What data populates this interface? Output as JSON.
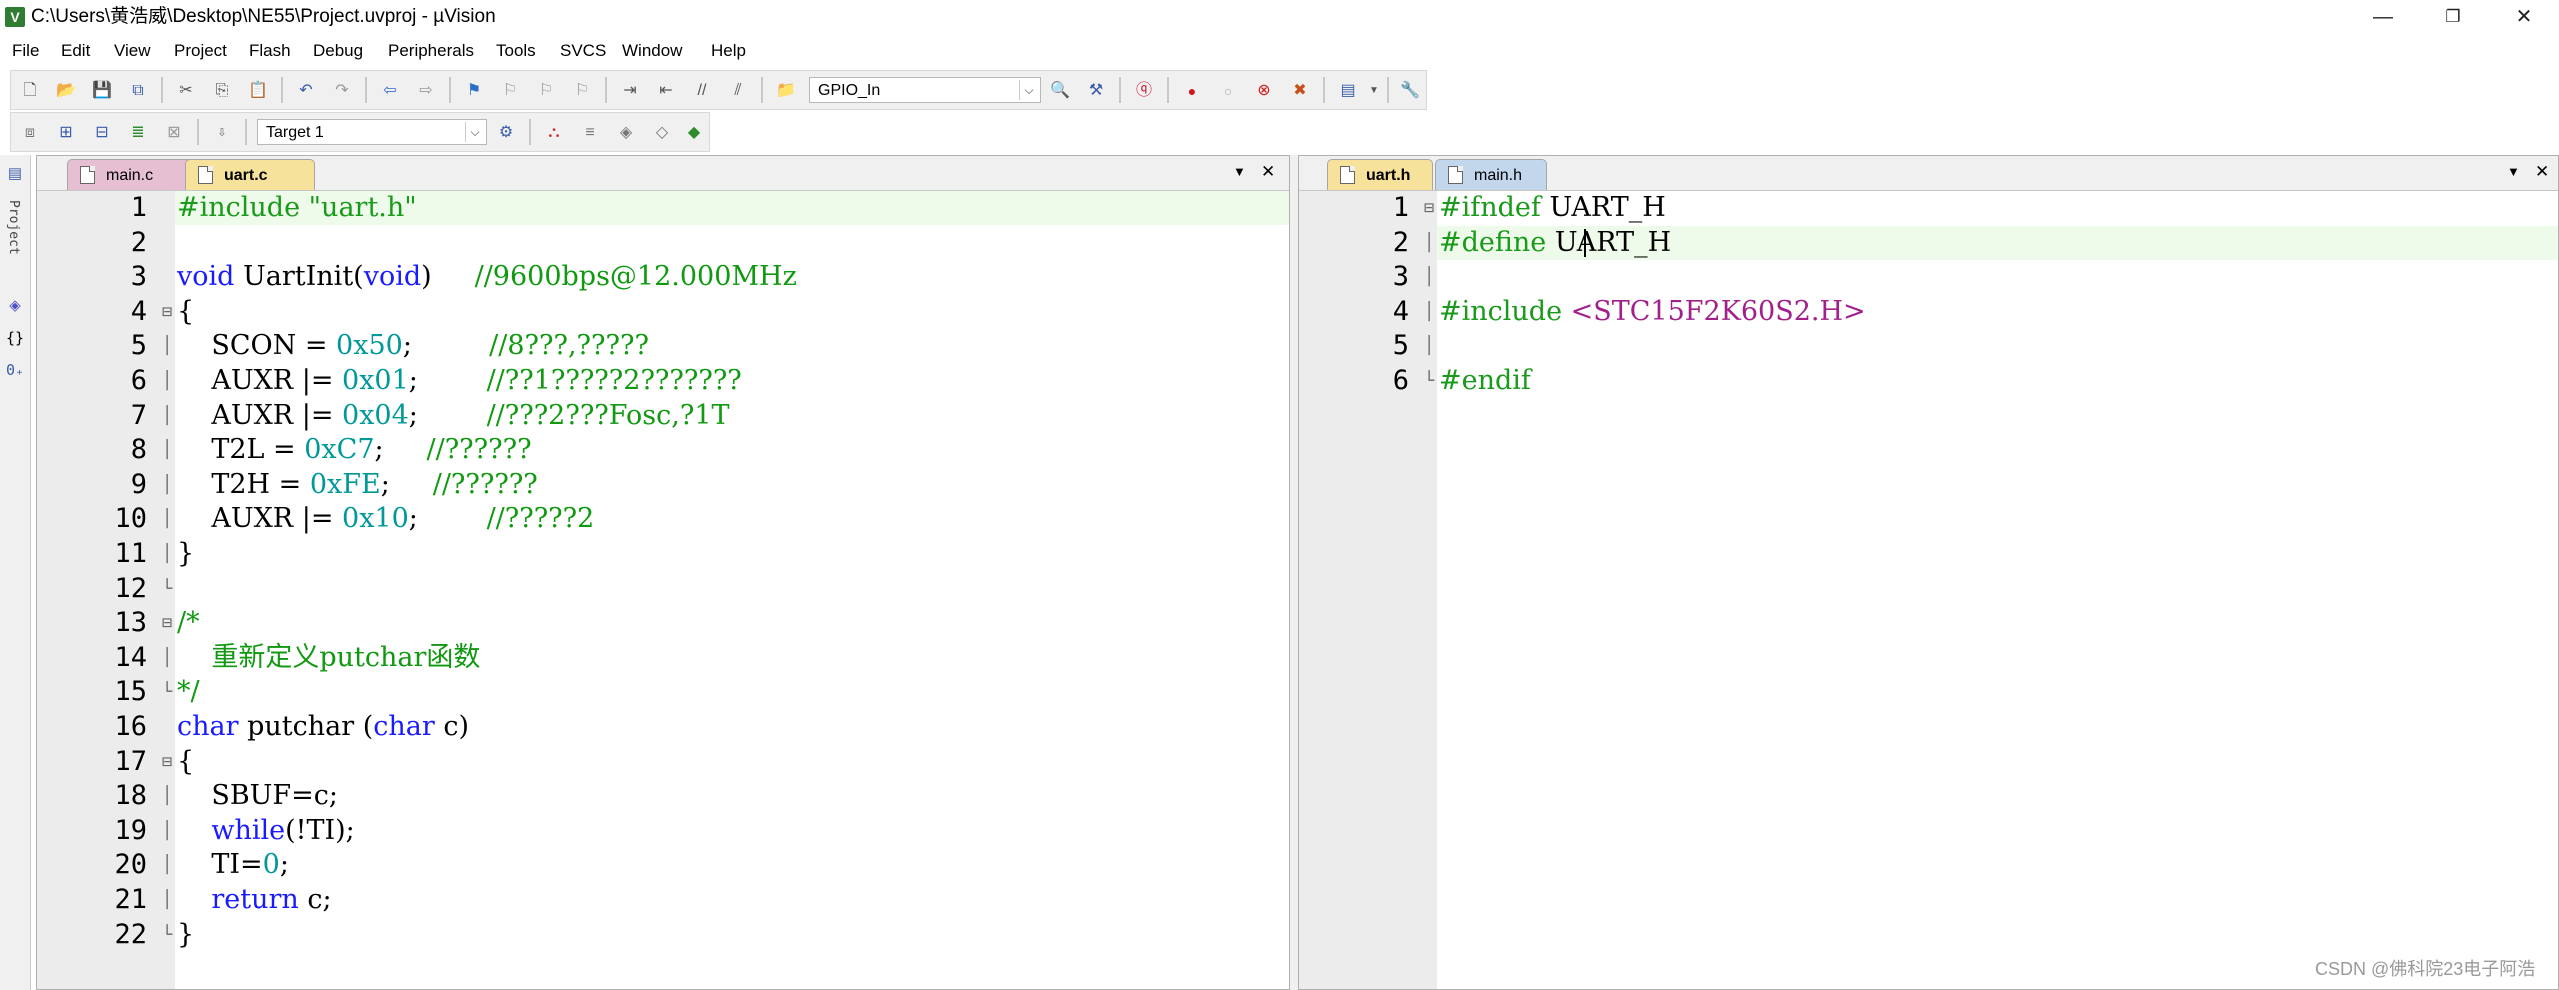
{
  "window": {
    "title": "C:\\Users\\黄浩威\\Desktop\\NE55\\Project.uvproj - µVision",
    "app_icon": "V",
    "minimize": "—",
    "restore": "❐",
    "close": "✕"
  },
  "menu": [
    "File",
    "Edit",
    "View",
    "Project",
    "Flash",
    "Debug",
    "Peripherals",
    "Tools",
    "SVCS",
    "Window",
    "Help"
  ],
  "toolbar1": {
    "target_combo": "GPIO_In",
    "combo_arrow": "⌵"
  },
  "toolbar2": {
    "target_select": "Target 1",
    "combo_arrow": "⌵"
  },
  "sidebar": {
    "project_label": "Project"
  },
  "left_pane": {
    "tabs": [
      {
        "label": "main.c",
        "active": false
      },
      {
        "label": "uart.c",
        "active": true
      }
    ],
    "menu_ctl": "▼",
    "close_ctl": "✕",
    "lines": [
      {
        "n": "1",
        "fold": "",
        "segs": [
          [
            "#include \"uart.h\"",
            "pp"
          ]
        ],
        "hl": true
      },
      {
        "n": "2",
        "fold": "",
        "segs": []
      },
      {
        "n": "3",
        "fold": "",
        "segs": [
          [
            "void",
            "k"
          ],
          [
            " UartInit(",
            "d"
          ],
          [
            "void",
            "k"
          ],
          [
            ")     ",
            "d"
          ],
          [
            "//9600bps@12.000MHz",
            "c"
          ]
        ]
      },
      {
        "n": "4",
        "fold": "⊟",
        "segs": [
          [
            "{",
            "d"
          ]
        ]
      },
      {
        "n": "5",
        "fold": "│",
        "segs": [
          [
            "    SCON = ",
            "d"
          ],
          [
            "0x50",
            "n"
          ],
          [
            ";         ",
            "d"
          ],
          [
            "//8???,?????",
            "c"
          ]
        ]
      },
      {
        "n": "6",
        "fold": "│",
        "segs": [
          [
            "    AUXR |= ",
            "d"
          ],
          [
            "0x01",
            "n"
          ],
          [
            ";        ",
            "d"
          ],
          [
            "//??1?????2???????",
            "c"
          ]
        ]
      },
      {
        "n": "7",
        "fold": "│",
        "segs": [
          [
            "    AUXR |= ",
            "d"
          ],
          [
            "0x04",
            "n"
          ],
          [
            ";        ",
            "d"
          ],
          [
            "//???2???Fosc,?1T",
            "c"
          ]
        ]
      },
      {
        "n": "8",
        "fold": "│",
        "segs": [
          [
            "    T2L = ",
            "d"
          ],
          [
            "0xC7",
            "n"
          ],
          [
            ";     ",
            "d"
          ],
          [
            "//??????",
            "c"
          ]
        ]
      },
      {
        "n": "9",
        "fold": "│",
        "segs": [
          [
            "    T2H = ",
            "d"
          ],
          [
            "0xFE",
            "n"
          ],
          [
            ";     ",
            "d"
          ],
          [
            "//??????",
            "c"
          ]
        ]
      },
      {
        "n": "10",
        "fold": "│",
        "segs": [
          [
            "    AUXR |= ",
            "d"
          ],
          [
            "0x10",
            "n"
          ],
          [
            ";        ",
            "d"
          ],
          [
            "//?????2",
            "c"
          ]
        ]
      },
      {
        "n": "11",
        "fold": "│",
        "segs": [
          [
            "}",
            "d"
          ]
        ]
      },
      {
        "n": "12",
        "fold": "└",
        "segs": []
      },
      {
        "n": "13",
        "fold": "⊟",
        "segs": [
          [
            "/*",
            "c"
          ]
        ]
      },
      {
        "n": "14",
        "fold": "│",
        "segs": [
          [
            "    重新定义putchar函数",
            "c"
          ]
        ]
      },
      {
        "n": "15",
        "fold": "└",
        "segs": [
          [
            "*/",
            "c"
          ]
        ]
      },
      {
        "n": "16",
        "fold": "",
        "segs": [
          [
            "char",
            "k"
          ],
          [
            " putchar (",
            "d"
          ],
          [
            "char",
            "k"
          ],
          [
            " c)",
            "d"
          ]
        ]
      },
      {
        "n": "17",
        "fold": "⊟",
        "segs": [
          [
            "{",
            "d"
          ]
        ]
      },
      {
        "n": "18",
        "fold": "│",
        "segs": [
          [
            "    SBUF=c;",
            "d"
          ]
        ]
      },
      {
        "n": "19",
        "fold": "│",
        "segs": [
          [
            "    ",
            "d"
          ],
          [
            "while",
            "k"
          ],
          [
            "(!TI);",
            "d"
          ]
        ]
      },
      {
        "n": "20",
        "fold": "│",
        "segs": [
          [
            "    TI=",
            "d"
          ],
          [
            "0",
            "n"
          ],
          [
            ";",
            "d"
          ]
        ]
      },
      {
        "n": "21",
        "fold": "│",
        "segs": [
          [
            "    ",
            "d"
          ],
          [
            "return",
            "k"
          ],
          [
            " c;",
            "d"
          ]
        ]
      },
      {
        "n": "22",
        "fold": "└",
        "segs": [
          [
            "}",
            "d"
          ]
        ]
      }
    ]
  },
  "right_pane": {
    "tabs": [
      {
        "label": "uart.h",
        "active": true
      },
      {
        "label": "main.h",
        "active": false
      }
    ],
    "menu_ctl": "▼",
    "close_ctl": "✕",
    "lines": [
      {
        "n": "1",
        "fold": "⊟",
        "segs": [
          [
            "#ifndef ",
            "pp"
          ],
          [
            "UART_H",
            "d"
          ]
        ]
      },
      {
        "n": "2",
        "fold": "│",
        "segs": [
          [
            "#define ",
            "pp"
          ],
          [
            "UART_H",
            "d"
          ]
        ],
        "hl": true
      },
      {
        "n": "3",
        "fold": "│",
        "segs": []
      },
      {
        "n": "4",
        "fold": "│",
        "segs": [
          [
            "#include ",
            "pp"
          ],
          [
            "<STC15F2K60S2.H>",
            "s"
          ]
        ]
      },
      {
        "n": "5",
        "fold": "│",
        "segs": []
      },
      {
        "n": "6",
        "fold": "└",
        "segs": [
          [
            "#endif",
            "pp"
          ]
        ]
      }
    ]
  },
  "watermark": "CSDN @佛科院23电子阿浩",
  "colors": {
    "keyword": "#1a1aff",
    "comment": "#119911",
    "number": "#00999a",
    "string": "#a0208c",
    "active_tab": "#f7e29b",
    "highlight_line": "#eefbea"
  }
}
